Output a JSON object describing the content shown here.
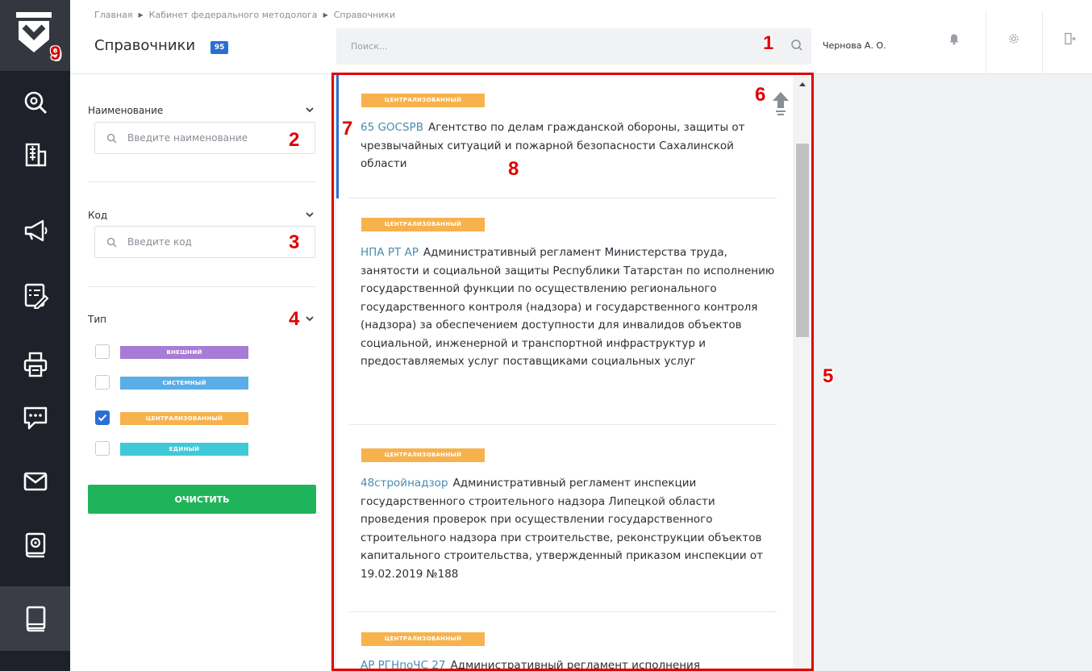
{
  "header": {
    "breadcrumbs": [
      "Главная",
      "Кабинет федерального методолога",
      "Справочники"
    ],
    "title": "Справочники",
    "count": "95",
    "search_placeholder": "Поиск...",
    "user": "Чернова А. О."
  },
  "rail": {
    "items": [
      "search-icon",
      "building-icon",
      "megaphone-icon",
      "checklist-icon",
      "printer-icon",
      "chat-icon",
      "mail-icon",
      "settings-book-icon",
      "book-icon"
    ],
    "active": "book-icon"
  },
  "filters": {
    "name": {
      "label": "Наименование",
      "placeholder": "Введите наименование"
    },
    "code": {
      "label": "Код",
      "placeholder": "Введите код"
    },
    "type": {
      "label": "Тип",
      "options": [
        {
          "label": "ВНЕШНИЙ",
          "color": "#a77bd6",
          "checked": false
        },
        {
          "label": "СИСТЕМНЫЙ",
          "color": "#5aaee8",
          "checked": false
        },
        {
          "label": "ЦЕНТРАЛИЗОВАННЫЙ",
          "color": "#f7b24d",
          "checked": true
        },
        {
          "label": "ЕДИНЫЙ",
          "color": "#3fc9d8",
          "checked": false
        }
      ]
    },
    "clear_label": "ОЧИСТИТЬ"
  },
  "list": {
    "items": [
      {
        "tag": "ЦЕНТРАЛИЗОВАННЫЙ",
        "code": "65 GOCSPB",
        "name": "Агентство по делам гражданской обороны, защиты от чрезвычайных ситуаций и пожарной безопасности Сахалинской области"
      },
      {
        "tag": "ЦЕНТРАЛИЗОВАННЫЙ",
        "code": "НПА РТ АР",
        "name": "Административный регламент Министерства труда, занятости и социальной защиты Республики Татарстан по исполнению государственной функции по осуществлению регионального государственного контроля (надзора) и государственного контроля (надзора) за обеспечением доступности для инвалидов объектов социальной, инженерной и транспортной инфраструктур и предоставляемых услуг поставщиками социальных услуг"
      },
      {
        "tag": "ЦЕНТРАЛИЗОВАННЫЙ",
        "code": "48стройнадзор",
        "name": "Административный регламент инспекции государственного строительного надзора Липецкой области проведения проверок при осуществлении государственного строительного надзора при строительстве, реконструкции объектов капитального строительства, утвержденный приказом инспекции от 19.02.2019 №188"
      },
      {
        "tag": "ЦЕНТРАЛИЗОВАННЫЙ",
        "code": "АР РГНпоЧС 27",
        "name": "Административный регламент исполнения"
      }
    ]
  },
  "annotations": [
    "1",
    "2",
    "3",
    "4",
    "5",
    "6",
    "7",
    "8",
    "9"
  ],
  "colors": {
    "accent": "#2b6fd6",
    "annotation": "#e00000",
    "clear_button": "#20b45a",
    "rail": "#1e2129"
  }
}
